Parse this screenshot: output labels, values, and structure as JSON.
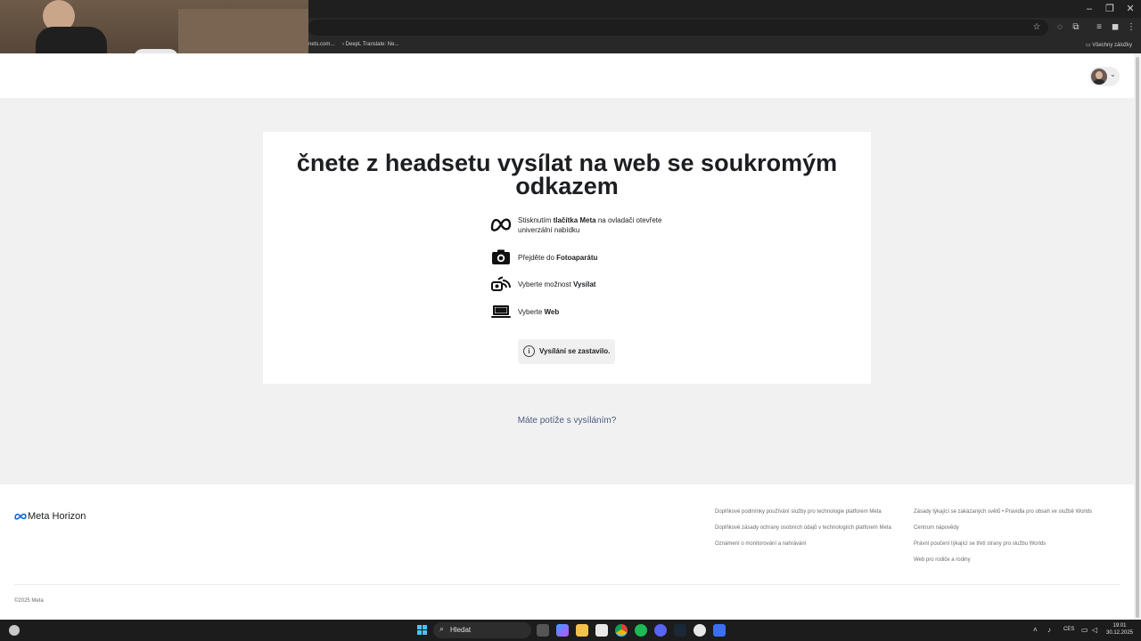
{
  "bookmarks": [
    {
      "label": "nets.com..."
    },
    {
      "label": "DeepL Translate: Ne..."
    }
  ],
  "bookmarks_all": "Všechny záložky",
  "card": {
    "title_line1": "čnete z headsetu vysílat na web se soukromým",
    "title_line2": "odkazem",
    "steps": [
      {
        "icon": "meta-logo-icon",
        "text_pre": "Stisknutím ",
        "text_bold": "tlačítka Meta",
        "text_post": " na ovladači otevřete univerzální nabídku"
      },
      {
        "icon": "camera-icon",
        "text_pre": "Přejděte do ",
        "text_bold": "Fotoaparátu",
        "text_post": ""
      },
      {
        "icon": "cast-icon",
        "text_pre": "Vyberte možnost ",
        "text_bold": "Vysílat",
        "text_post": ""
      },
      {
        "icon": "laptop-icon",
        "text_pre": "Vyberte ",
        "text_bold": "Web",
        "text_post": ""
      }
    ],
    "status": "Vysílání se zastavilo."
  },
  "help_link": "Máte potíže s vysíláním?",
  "footer": {
    "brand": "Meta Horizon",
    "links_col1": [
      "Doplňkové podmínky používání služby pro technologie platforem Meta",
      "Doplňkové zásady ochrany osobních údajů v technologiích platforem Meta",
      "Oznámení o monitorování a nahrávání"
    ],
    "links_col2": [
      "Zásady týkající se zakázaných světů • Pravidla pro obsah ve službě Worlds",
      "Centrum nápovědy",
      "Právní poučení týkající se třetí strany pro službu Worlds",
      "Web pro rodiče a rodiny"
    ],
    "copyright": "©2025 Meta"
  },
  "taskbar": {
    "search_label": "Hledat",
    "language": "CES",
    "time": "19:01",
    "date": "30.12.2025"
  },
  "colors": {
    "accent_blue": "#4cc2ff",
    "page_bg": "#f1f1f1",
    "link": "#4a5a80"
  }
}
